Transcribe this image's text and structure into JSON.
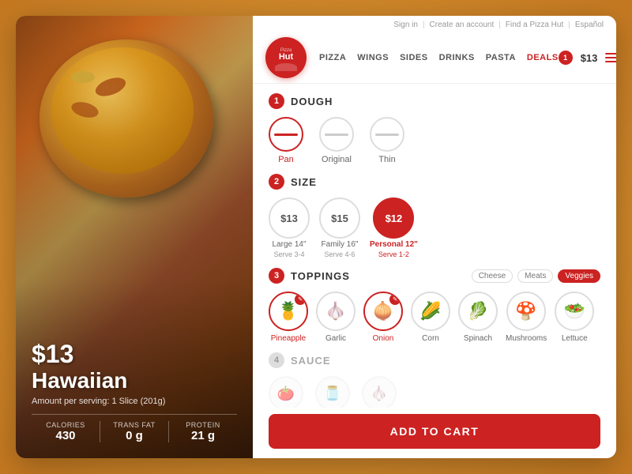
{
  "app": {
    "title": "Pizza Hut",
    "brand": {
      "pizza": "Pizza",
      "hut": "Hut"
    }
  },
  "header": {
    "top_links": [
      "Sign in",
      "Create an account",
      "Find a Pizza Hut",
      "Español"
    ],
    "nav_items": [
      {
        "label": "PIZZA",
        "active": false
      },
      {
        "label": "WINGS",
        "active": false
      },
      {
        "label": "SIDES",
        "active": false
      },
      {
        "label": "DRINKS",
        "active": false
      },
      {
        "label": "PASTA",
        "active": false
      },
      {
        "label": "DEALS",
        "active": true
      }
    ],
    "cart_count": "1",
    "cart_price": "$13"
  },
  "pizza": {
    "price": "$13",
    "name": "Hawaiian",
    "serving": "Amount per serving: 1 Slice (201g)"
  },
  "nutrition": {
    "calories_label": "CALORIES",
    "calories_value": "430",
    "transfat_label": "TRANS FAT",
    "transfat_value": "0 g",
    "protein_label": "PROTEIN",
    "protein_value": "21 g"
  },
  "sections": {
    "dough": {
      "number": "1",
      "title": "DOUGH",
      "options": [
        {
          "label": "Pan",
          "selected": true
        },
        {
          "label": "Original",
          "selected": false
        },
        {
          "label": "Thin",
          "selected": false
        }
      ]
    },
    "size": {
      "number": "2",
      "title": "SIZE",
      "options": [
        {
          "price": "$13",
          "name": "Large 14\"",
          "serve": "Serve 3-4",
          "selected": false
        },
        {
          "price": "$15",
          "name": "Family 16\"",
          "serve": "Serve 4-6",
          "selected": false
        },
        {
          "price": "$12",
          "name": "Personal 12\"",
          "serve": "Serve 1-2",
          "selected": true
        }
      ]
    },
    "toppings": {
      "number": "3",
      "title": "TOPPINGS",
      "filters": [
        {
          "label": "Cheese",
          "active": false
        },
        {
          "label": "Meats",
          "active": false
        },
        {
          "label": "Veggies",
          "active": true
        }
      ],
      "items": [
        {
          "name": "Pineapple",
          "emoji": "🍍",
          "selected": true
        },
        {
          "name": "Garlic",
          "emoji": "🧄",
          "selected": false
        },
        {
          "name": "Onion",
          "emoji": "🧅",
          "selected": true
        },
        {
          "name": "Corn",
          "emoji": "🌽",
          "selected": false
        },
        {
          "name": "Spinach",
          "emoji": "🥬",
          "selected": false
        },
        {
          "name": "Mushrooms",
          "emoji": "🍄",
          "selected": false
        },
        {
          "name": "Lettuce",
          "emoji": "🥗",
          "selected": false
        }
      ]
    },
    "sauce": {
      "number": "4",
      "title": "SAUCE"
    }
  },
  "cart": {
    "button_label": "ADD TO CART"
  }
}
